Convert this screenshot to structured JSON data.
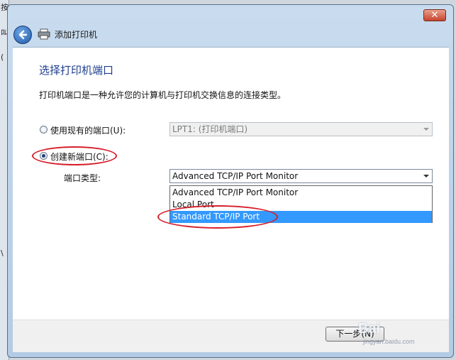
{
  "background": {
    "fragments": [
      "按",
      "区",
      "叫",
      "(",
      "\\"
    ]
  },
  "window": {
    "title": "添加打印机",
    "close_glyph": "✕"
  },
  "page": {
    "heading": "选择打印机端口",
    "description": "打印机端口是一种允许您的计算机与打印机交换信息的连接类型。"
  },
  "options": {
    "existing_label": "使用现有的端口(U):",
    "existing_value": "LPT1: (打印机端口)",
    "new_label": "创建新端口(C):",
    "port_type_label": "端口类型:",
    "port_type_value": "Advanced TCP/IP Port Monitor",
    "dropdown_items": [
      "Advanced TCP/IP Port Monitor",
      "Local Port",
      "Standard TCP/IP Port"
    ]
  },
  "footer": {
    "next_label": "下一步(N)"
  },
  "watermark": {
    "text": "Bai",
    "sub": "jingyan.baidu.com"
  },
  "colors": {
    "heading": "#1e3d8f",
    "selection": "#3399ff",
    "annotation": "#d61f2b"
  }
}
